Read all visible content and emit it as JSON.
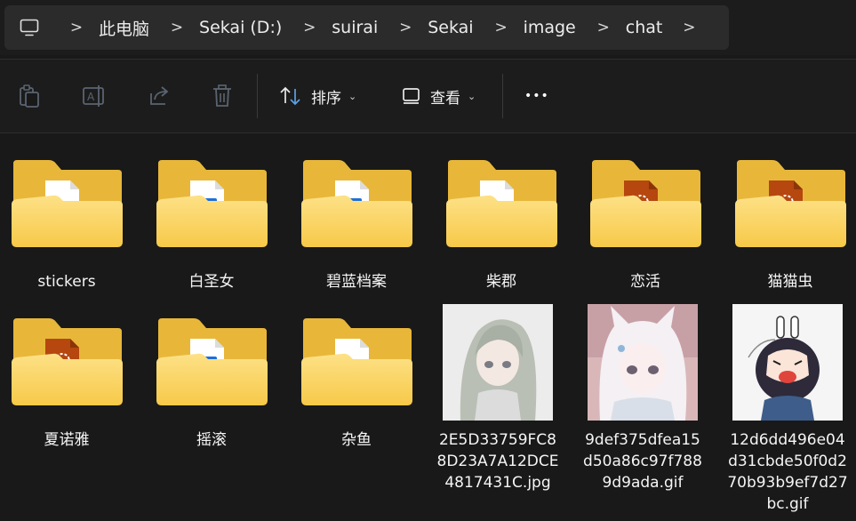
{
  "address": {
    "pc_icon": "monitor-icon",
    "crumbs": [
      "此电脑",
      "Sekai (D:)",
      "suirai",
      "Sekai",
      "image",
      "chat"
    ]
  },
  "toolbar": {
    "copy_icon": "copy-icon",
    "rename_icon": "rename-icon",
    "share_icon": "share-icon",
    "delete_icon": "trash-icon",
    "sort_label": "排序",
    "view_label": "查看",
    "more_label": "•••"
  },
  "items": [
    {
      "name": "stickers",
      "type": "folder",
      "content": "document"
    },
    {
      "name": "白圣女",
      "type": "folder",
      "content": "image"
    },
    {
      "name": "碧蓝档案",
      "type": "folder",
      "content": "image"
    },
    {
      "name": "柴郡",
      "type": "folder",
      "content": "document"
    },
    {
      "name": "恋活",
      "type": "folder",
      "content": "media"
    },
    {
      "name": "猫猫虫",
      "type": "folder",
      "content": "media"
    },
    {
      "name": "夏诺雅",
      "type": "folder",
      "content": "media"
    },
    {
      "name": "摇滚",
      "type": "folder",
      "content": "image"
    },
    {
      "name": "杂鱼",
      "type": "folder",
      "content": "document"
    },
    {
      "name": "2E5D33759FC88D23A7A12DCE4817431C.jpg",
      "type": "file"
    },
    {
      "name": "9def375dfea15d50a86c97f7889d9ada.gif",
      "type": "file"
    },
    {
      "name": "12d6dd496e04d31cbde50f0d270b93b9ef7d27bc.gif",
      "type": "file"
    }
  ],
  "colors": {
    "background": "#191919",
    "folder_back": "#e8b73a",
    "folder_front": "#fbd36b"
  }
}
